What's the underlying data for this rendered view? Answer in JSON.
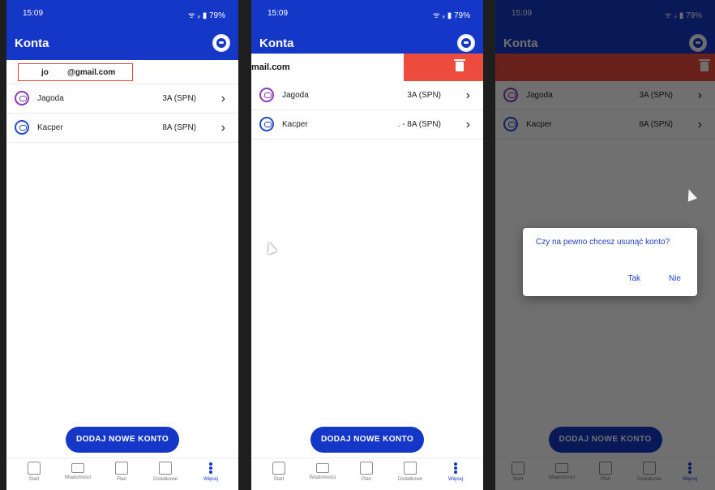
{
  "statusbar": {
    "time": "15:09",
    "battery": "79%",
    "icons": "◻ ▦ ◍ •",
    "signal": "ᯤ ᵥ ▮"
  },
  "appbar": {
    "title": "Konta"
  },
  "email": {
    "prefix": "jo",
    "suffix": "@gmail.com",
    "swipe_suffix": "mail.com"
  },
  "accounts": [
    {
      "name": "Jagoda",
      "class": "3A (SPN)",
      "avatar": "purple"
    },
    {
      "name": "Kacper",
      "class": "8A (SPN)",
      "avatar": "blue"
    }
  ],
  "accounts_alt": {
    "kacper_class": ". - 8A (SPN)"
  },
  "cta": "DODAJ NOWE KONTO",
  "nav": [
    "Start",
    "Wiadomości",
    "Plan",
    "Dodatkowe",
    "Więcej"
  ],
  "dialog": {
    "message": "Czy na pewno chcesz usunąć konto?",
    "yes": "Tak",
    "no": "Nie"
  },
  "colors": {
    "primary": "#1537c7",
    "danger": "#ee4b3f",
    "overlay": "rgba(0,0,0,0.56)"
  }
}
